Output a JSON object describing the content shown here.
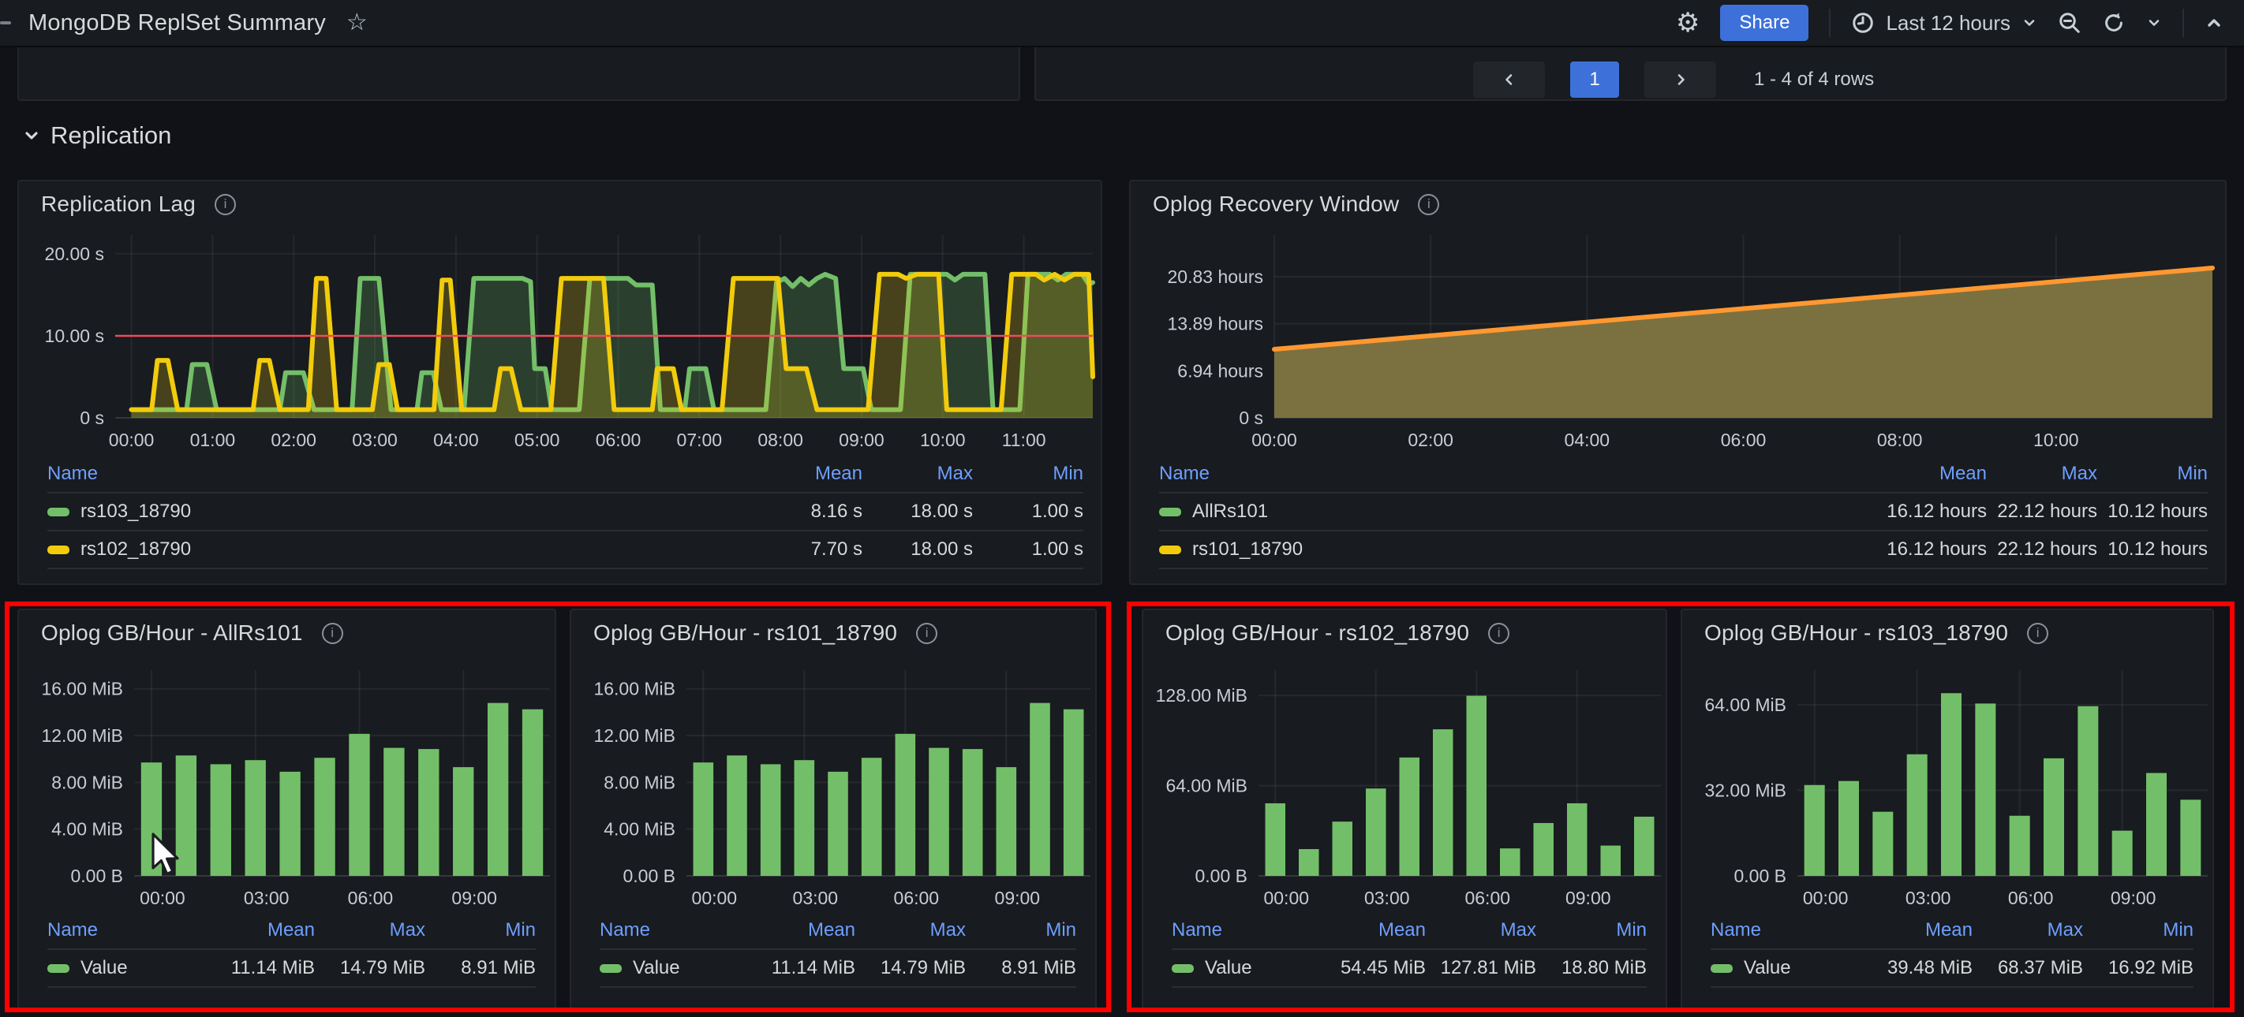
{
  "topbar": {
    "title": "MongoDB ReplSet Summary",
    "star_icon": "star-outline",
    "share_label": "Share",
    "time_range": "Last 12 hours",
    "icons": [
      "gear-icon",
      "clock-icon",
      "chevron-down-icon",
      "zoom-out-icon",
      "refresh-icon",
      "chevron-down-icon",
      "chevron-up-icon"
    ]
  },
  "pagination": {
    "page": "1",
    "info": "1 - 4 of 4 rows"
  },
  "section": {
    "title": "Replication"
  },
  "colors": {
    "accent_blue": "#3d71d9",
    "link_blue": "#6e9fff",
    "series_green": "#73bf69",
    "series_yellow": "#f2cc0c",
    "series_orange": "#ff9830",
    "threshold_red": "#f2495c",
    "highlight_red": "#ff0000",
    "panel_bg": "#181b1f",
    "page_bg": "#111217"
  },
  "panels": [
    {
      "id": "replication-lag",
      "title": "Replication Lag",
      "legend": {
        "headers": [
          "Name",
          "Mean",
          "Max",
          "Min"
        ],
        "rows": [
          {
            "name": "rs103_18790",
            "color": "#73bf69",
            "values": [
              "8.16 s",
              "18.00 s",
              "1.00 s"
            ]
          },
          {
            "name": "rs102_18790",
            "color": "#f2cc0c",
            "values": [
              "7.70 s",
              "18.00 s",
              "1.00 s"
            ]
          }
        ]
      }
    },
    {
      "id": "oplog-recovery",
      "title": "Oplog Recovery Window",
      "legend": {
        "headers": [
          "Name",
          "Mean",
          "Max",
          "Min"
        ],
        "rows": [
          {
            "name": "AllRs101",
            "color": "#73bf69",
            "values": [
              "16.12 hours",
              "22.12 hours",
              "10.12 hours"
            ]
          },
          {
            "name": "rs101_18790",
            "color": "#f2cc0c",
            "values": [
              "16.12 hours",
              "22.12 hours",
              "10.12 hours"
            ]
          }
        ]
      }
    },
    {
      "id": "oplog-allrs101",
      "title": "Oplog GB/Hour - AllRs101",
      "legend": {
        "headers": [
          "Name",
          "Mean",
          "Max",
          "Min"
        ],
        "rows": [
          {
            "name": "Value",
            "color": "#73bf69",
            "values": [
              "11.14 MiB",
              "14.79 MiB",
              "8.91 MiB"
            ]
          }
        ]
      }
    },
    {
      "id": "oplog-rs101",
      "title": "Oplog GB/Hour - rs101_18790",
      "legend": {
        "headers": [
          "Name",
          "Mean",
          "Max",
          "Min"
        ],
        "rows": [
          {
            "name": "Value",
            "color": "#73bf69",
            "values": [
              "11.14 MiB",
              "14.79 MiB",
              "8.91 MiB"
            ]
          }
        ]
      }
    },
    {
      "id": "oplog-rs102",
      "title": "Oplog GB/Hour - rs102_18790",
      "legend": {
        "headers": [
          "Name",
          "Mean",
          "Max",
          "Min"
        ],
        "rows": [
          {
            "name": "Value",
            "color": "#73bf69",
            "values": [
              "54.45 MiB",
              "127.81 MiB",
              "18.80 MiB"
            ]
          }
        ]
      }
    },
    {
      "id": "oplog-rs103",
      "title": "Oplog GB/Hour - rs103_18790",
      "legend": {
        "headers": [
          "Name",
          "Mean",
          "Max",
          "Min"
        ],
        "rows": [
          {
            "name": "Value",
            "color": "#73bf69",
            "values": [
              "39.48 MiB",
              "68.37 MiB",
              "16.92 MiB"
            ]
          }
        ]
      }
    }
  ],
  "chart_data": [
    {
      "id": "replication-lag",
      "type": "line",
      "title": "Replication Lag",
      "xlim": [
        -0.2,
        11.85
      ],
      "ylim": [
        0,
        22.3
      ],
      "xticks": [
        {
          "v": 0,
          "label": "00:00"
        },
        {
          "v": 1,
          "label": "01:00"
        },
        {
          "v": 2,
          "label": "02:00"
        },
        {
          "v": 3,
          "label": "03:00"
        },
        {
          "v": 4,
          "label": "04:00"
        },
        {
          "v": 5,
          "label": "05:00"
        },
        {
          "v": 6,
          "label": "06:00"
        },
        {
          "v": 7,
          "label": "07:00"
        },
        {
          "v": 8,
          "label": "08:00"
        },
        {
          "v": 9,
          "label": "09:00"
        },
        {
          "v": 10,
          "label": "10:00"
        },
        {
          "v": 11,
          "label": "11:00"
        }
      ],
      "yticks": [
        {
          "v": 0,
          "label": "0 s"
        },
        {
          "v": 10,
          "label": "10.00 s"
        },
        {
          "v": 20,
          "label": "20.00 s"
        }
      ],
      "threshold": {
        "v": 10,
        "color": "#f2495c"
      },
      "margins": {
        "l": 122,
        "r": 10,
        "t": 12,
        "b": 46
      },
      "series": [
        {
          "name": "rs103_18790",
          "color": "#73bf69",
          "stroke_width": 6,
          "fill_opacity": 0.22,
          "points": [
            [
              0,
              1
            ],
            [
              0.68,
              1
            ],
            [
              0.75,
              6.5
            ],
            [
              0.93,
              6.5
            ],
            [
              1.05,
              1
            ],
            [
              1.83,
              1
            ],
            [
              1.9,
              5.5
            ],
            [
              2.12,
              5.5
            ],
            [
              2.25,
              1
            ],
            [
              2.72,
              1
            ],
            [
              2.82,
              17
            ],
            [
              3.05,
              17
            ],
            [
              3.2,
              1
            ],
            [
              3.52,
              1
            ],
            [
              3.58,
              5.5
            ],
            [
              3.72,
              5.5
            ],
            [
              3.82,
              1
            ],
            [
              4.1,
              1
            ],
            [
              4.22,
              17
            ],
            [
              4.82,
              17
            ],
            [
              4.92,
              16.6
            ],
            [
              4.97,
              6
            ],
            [
              5.1,
              6
            ],
            [
              5.18,
              1
            ],
            [
              5.52,
              1
            ],
            [
              5.65,
              17
            ],
            [
              6.12,
              17
            ],
            [
              6.22,
              16.2
            ],
            [
              6.42,
              16.2
            ],
            [
              6.52,
              1
            ],
            [
              6.82,
              1
            ],
            [
              6.88,
              6
            ],
            [
              7.08,
              6
            ],
            [
              7.18,
              1
            ],
            [
              7.82,
              1
            ],
            [
              7.95,
              16.5
            ],
            [
              8.05,
              17
            ],
            [
              8.15,
              16
            ],
            [
              8.25,
              17
            ],
            [
              8.35,
              16.2
            ],
            [
              8.45,
              17
            ],
            [
              8.55,
              17.5
            ],
            [
              8.68,
              17
            ],
            [
              8.78,
              6
            ],
            [
              9.02,
              6
            ],
            [
              9.12,
              1
            ],
            [
              9.48,
              1
            ],
            [
              9.6,
              17.5
            ],
            [
              10.05,
              17.5
            ],
            [
              10.15,
              16.8
            ],
            [
              10.25,
              17.5
            ],
            [
              10.52,
              17.5
            ],
            [
              10.62,
              1
            ],
            [
              10.95,
              1
            ],
            [
              11.05,
              17.5
            ],
            [
              11.32,
              17.5
            ],
            [
              11.42,
              16.8
            ],
            [
              11.52,
              17.5
            ],
            [
              11.72,
              17.5
            ],
            [
              11.8,
              16.3
            ],
            [
              11.85,
              16.5
            ]
          ]
        },
        {
          "name": "rs102_18790",
          "color": "#f2cc0c",
          "stroke_width": 6,
          "fill_opacity": 0.22,
          "points": [
            [
              0,
              1
            ],
            [
              0.25,
              1
            ],
            [
              0.32,
              7
            ],
            [
              0.45,
              7
            ],
            [
              0.57,
              1
            ],
            [
              1.5,
              1
            ],
            [
              1.58,
              7
            ],
            [
              1.7,
              7
            ],
            [
              1.83,
              1
            ],
            [
              2.18,
              1
            ],
            [
              2.28,
              17
            ],
            [
              2.4,
              17
            ],
            [
              2.53,
              1
            ],
            [
              2.97,
              1
            ],
            [
              3.05,
              6.5
            ],
            [
              3.18,
              6.5
            ],
            [
              3.28,
              1
            ],
            [
              3.73,
              1
            ],
            [
              3.83,
              16.8
            ],
            [
              3.93,
              16.8
            ],
            [
              4.07,
              1
            ],
            [
              4.47,
              1
            ],
            [
              4.55,
              6
            ],
            [
              4.68,
              6
            ],
            [
              4.8,
              1
            ],
            [
              5.17,
              1
            ],
            [
              5.3,
              17
            ],
            [
              5.82,
              17
            ],
            [
              5.95,
              1
            ],
            [
              6.42,
              1
            ],
            [
              6.48,
              6
            ],
            [
              6.68,
              6
            ],
            [
              6.78,
              1
            ],
            [
              7.28,
              1
            ],
            [
              7.42,
              17
            ],
            [
              7.97,
              17
            ],
            [
              8.07,
              6
            ],
            [
              8.32,
              6
            ],
            [
              8.45,
              1
            ],
            [
              9.08,
              1
            ],
            [
              9.22,
              17.5
            ],
            [
              9.45,
              17.5
            ],
            [
              9.55,
              17
            ],
            [
              9.68,
              17.5
            ],
            [
              9.95,
              17.5
            ],
            [
              10.05,
              1
            ],
            [
              10.72,
              1
            ],
            [
              10.85,
              17.5
            ],
            [
              11.15,
              17.5
            ],
            [
              11.25,
              16.8
            ],
            [
              11.38,
              17.5
            ],
            [
              11.5,
              16.8
            ],
            [
              11.62,
              17.5
            ],
            [
              11.8,
              17.5
            ],
            [
              11.85,
              5
            ]
          ]
        }
      ]
    },
    {
      "id": "oplog-recovery",
      "type": "line",
      "title": "Oplog Recovery Window",
      "xlim": [
        0,
        12
      ],
      "ylim": [
        0,
        27
      ],
      "xticks": [
        {
          "v": 0,
          "label": "00:00"
        },
        {
          "v": 2,
          "label": "02:00"
        },
        {
          "v": 4,
          "label": "04:00"
        },
        {
          "v": 6,
          "label": "06:00"
        },
        {
          "v": 8,
          "label": "08:00"
        },
        {
          "v": 10,
          "label": "10:00"
        }
      ],
      "yticks": [
        {
          "v": 0,
          "label": "0 s"
        },
        {
          "v": 6.94,
          "label": "6.94 hours"
        },
        {
          "v": 13.89,
          "label": "13.89 hours"
        },
        {
          "v": 20.83,
          "label": "20.83 hours"
        }
      ],
      "margins": {
        "l": 182,
        "r": 16,
        "t": 12,
        "b": 46
      },
      "series": [
        {
          "name": "AllRs101 / rs101_18790",
          "color": "#ff9830",
          "stroke_width": 6,
          "fill_color": "#7b7140",
          "fill_opacity": 1,
          "points": [
            [
              0,
              10.12
            ],
            [
              12,
              22.12
            ]
          ]
        }
      ]
    },
    {
      "id": "oplog-allrs101",
      "type": "bar",
      "title": "Oplog GB/Hour - AllRs101",
      "bar_color": "#73bf69",
      "categories": [
        "00:00",
        "01:00",
        "02:00",
        "03:00",
        "04:00",
        "05:00",
        "06:00",
        "07:00",
        "08:00",
        "09:00",
        "10:00",
        "11:00"
      ],
      "values": [
        9.7,
        10.3,
        9.55,
        9.9,
        8.91,
        10.1,
        12.15,
        10.95,
        10.85,
        9.3,
        14.79,
        14.25
      ],
      "xtick_indices": [
        0,
        3,
        6,
        9
      ],
      "yticks": [
        {
          "v": 0,
          "label": "0.00 B"
        },
        {
          "v": 4,
          "label": "4.00 MiB"
        },
        {
          "v": 8,
          "label": "8.00 MiB"
        },
        {
          "v": 12,
          "label": "12.00 MiB"
        },
        {
          "v": 16,
          "label": "16.00 MiB"
        }
      ],
      "ylim": [
        0,
        17.6
      ],
      "margins": {
        "l": 146,
        "r": 6,
        "t": 16,
        "b": 42
      }
    },
    {
      "id": "oplog-rs101",
      "type": "bar",
      "title": "Oplog GB/Hour - rs101_18790",
      "bar_color": "#73bf69",
      "categories": [
        "00:00",
        "01:00",
        "02:00",
        "03:00",
        "04:00",
        "05:00",
        "06:00",
        "07:00",
        "08:00",
        "09:00",
        "10:00",
        "11:00"
      ],
      "values": [
        9.7,
        10.3,
        9.55,
        9.9,
        8.91,
        10.1,
        12.15,
        10.95,
        10.85,
        9.3,
        14.79,
        14.25
      ],
      "xtick_indices": [
        0,
        3,
        6,
        9
      ],
      "yticks": [
        {
          "v": 0,
          "label": "0.00 B"
        },
        {
          "v": 4,
          "label": "4.00 MiB"
        },
        {
          "v": 8,
          "label": "8.00 MiB"
        },
        {
          "v": 12,
          "label": "12.00 MiB"
        },
        {
          "v": 16,
          "label": "16.00 MiB"
        }
      ],
      "ylim": [
        0,
        17.6
      ],
      "margins": {
        "l": 146,
        "r": 6,
        "t": 16,
        "b": 42
      }
    },
    {
      "id": "oplog-rs102",
      "type": "bar",
      "title": "Oplog GB/Hour - rs102_18790",
      "bar_color": "#73bf69",
      "categories": [
        "00:00",
        "01:00",
        "02:00",
        "03:00",
        "04:00",
        "05:00",
        "06:00",
        "07:00",
        "08:00",
        "09:00",
        "10:00",
        "11:00"
      ],
      "values": [
        51.5,
        19,
        38.5,
        62,
        84,
        104,
        127.81,
        19.5,
        37.5,
        51.5,
        21.5,
        42
      ],
      "xtick_indices": [
        0,
        3,
        6,
        9
      ],
      "yticks": [
        {
          "v": 0,
          "label": "0.00 B"
        },
        {
          "v": 64,
          "label": "64.00 MiB"
        },
        {
          "v": 128,
          "label": "128.00 MiB"
        }
      ],
      "ylim": [
        0,
        146
      ],
      "margins": {
        "l": 146,
        "r": 6,
        "t": 16,
        "b": 42
      }
    },
    {
      "id": "oplog-rs103",
      "type": "bar",
      "title": "Oplog GB/Hour - rs103_18790",
      "bar_color": "#73bf69",
      "categories": [
        "00:00",
        "01:00",
        "02:00",
        "03:00",
        "04:00",
        "05:00",
        "06:00",
        "07:00",
        "08:00",
        "09:00",
        "10:00",
        "11:00"
      ],
      "values": [
        34,
        35.5,
        24,
        45.5,
        68.37,
        64.5,
        22.5,
        44,
        63.5,
        16.92,
        38.5,
        28.5
      ],
      "xtick_indices": [
        0,
        3,
        6,
        9
      ],
      "yticks": [
        {
          "v": 0,
          "label": "0.00 B"
        },
        {
          "v": 32,
          "label": "32.00 MiB"
        },
        {
          "v": 64,
          "label": "64.00 MiB"
        }
      ],
      "ylim": [
        0,
        77
      ],
      "margins": {
        "l": 146,
        "r": 6,
        "t": 16,
        "b": 42
      }
    }
  ]
}
